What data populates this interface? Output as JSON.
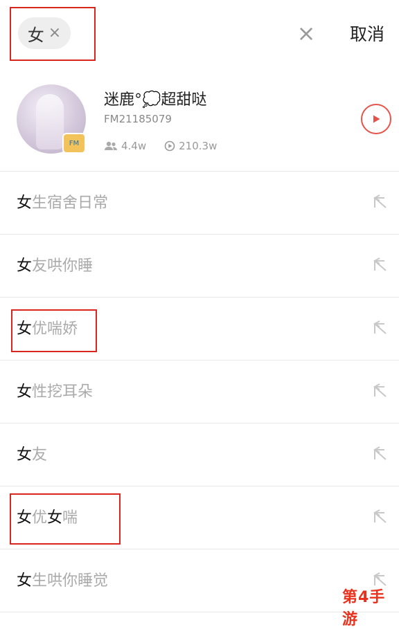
{
  "search": {
    "chip_text": "女",
    "chip_remove": "×",
    "clear": "×",
    "cancel": "取消"
  },
  "profile": {
    "name": "迷鹿°💭超甜哒",
    "id": "FM21185079",
    "fans": "4.4w",
    "plays": "210.3w"
  },
  "suggestions": [
    {
      "key": "女",
      "rest": "生宿舍日常"
    },
    {
      "key": "女",
      "rest": "友哄你睡"
    },
    {
      "key": "女",
      "rest": "优喘娇"
    },
    {
      "key": "女",
      "rest": "性挖耳朵"
    },
    {
      "key": "女",
      "rest": "友"
    },
    {
      "key": "女",
      "rest": "优",
      "key2": "女",
      "rest2": "喘"
    },
    {
      "key": "女",
      "rest": "生哄你睡觉"
    }
  ],
  "watermark": "第4手游",
  "colors": {
    "accent": "#e5534b",
    "highlight": "#d9251e"
  }
}
